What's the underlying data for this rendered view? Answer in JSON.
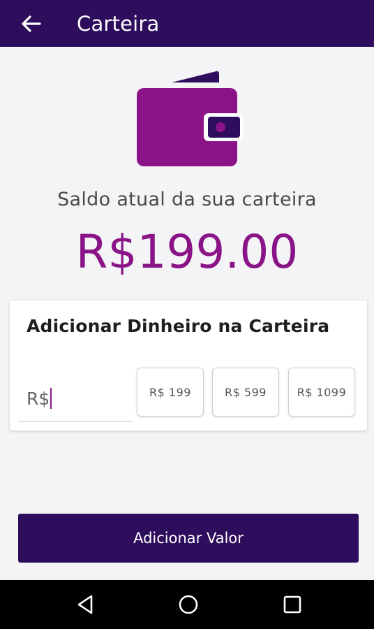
{
  "app": {
    "title": "Carteira",
    "back_icon": "arrow-left-icon"
  },
  "wallet": {
    "icon": "wallet-icon",
    "balance_label": "Saldo atual da sua carteira",
    "balance_value": "R$199.00",
    "accent_color": "#8a1487",
    "brand_color": "#2d0d5c"
  },
  "add_money": {
    "title": "Adicionar Dinheiro na Carteira",
    "input_value": "R$",
    "quick_amounts": [
      "R$ 199",
      "R$ 599",
      "R$ 1099"
    ]
  },
  "actions": {
    "submit_label": "Adicionar Valor"
  },
  "system_nav": {
    "icons": [
      "nav-back-icon",
      "nav-home-icon",
      "nav-recents-icon"
    ]
  }
}
